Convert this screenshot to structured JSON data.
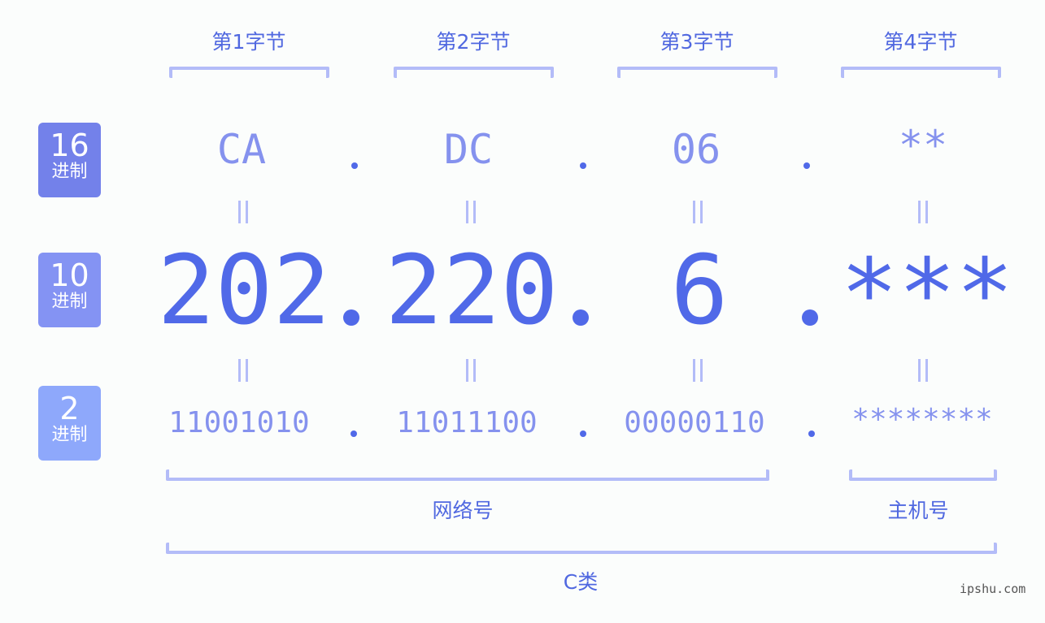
{
  "bytes": {
    "headers": [
      "第1字节",
      "第2字节",
      "第3字节",
      "第4字节"
    ]
  },
  "bases": [
    {
      "number": "16",
      "label": "进制",
      "color": "#7381ea"
    },
    {
      "number": "10",
      "label": "进制",
      "color": "#8493f3"
    },
    {
      "number": "2",
      "label": "进制",
      "color": "#8ea8fb"
    }
  ],
  "hex": {
    "values": [
      "CA",
      "DC",
      "06",
      "**"
    ],
    "separator": "."
  },
  "decimal": {
    "values": [
      "202",
      "220",
      "6",
      "***"
    ],
    "separator": "."
  },
  "binary": {
    "values": [
      "11001010",
      "11011100",
      "00000110",
      "********"
    ],
    "separator": "."
  },
  "equals_symbol": "=",
  "parts": {
    "network": "网络号",
    "host": "主机号",
    "class": "C类"
  },
  "watermark": "ipshu.com",
  "colors": {
    "primary": "#5069e8",
    "light": "#8592ee",
    "bracket": "#b3bcf8",
    "background": "#fbfdfc"
  }
}
